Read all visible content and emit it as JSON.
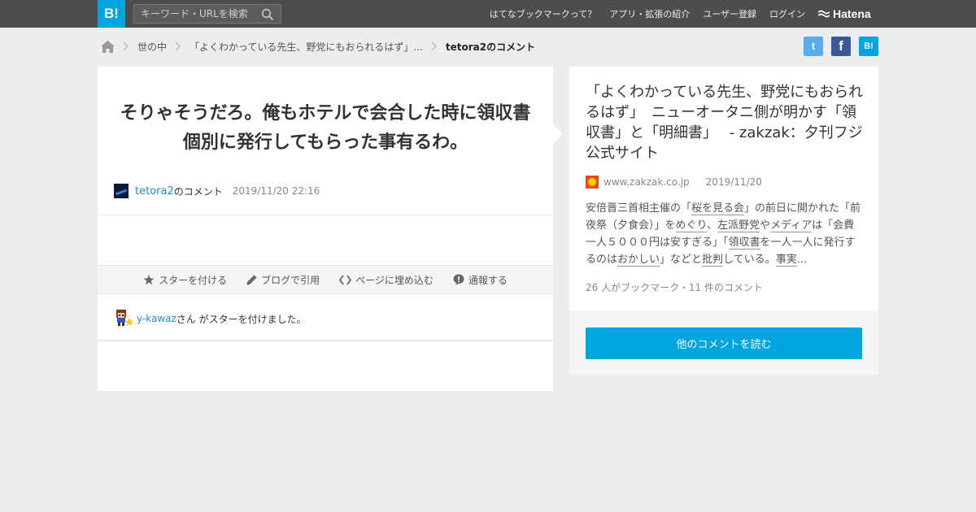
{
  "header": {
    "logo": "B!",
    "search_placeholder": "キーワード・URLを検索",
    "nav": [
      "はてなブックマークって？",
      "アプリ・拡張の紹介",
      "ユーザー登録",
      "ログイン"
    ],
    "hatena": "Hatena"
  },
  "breadcrumb": {
    "category": "世の中",
    "entry": "「よくわかっている先生、野党にもおられるはず」...",
    "current": "tetora2のコメント"
  },
  "share": {
    "twitter": "t",
    "facebook": "f",
    "hatebu": "B!"
  },
  "comment": {
    "text": "そりゃそうだろ。俺もホテルで会合した時に領収書個別に発行してもらった事有るわ。",
    "user": "tetora2",
    "no_comment": "のコメント",
    "timestamp": "2019/11/20 22:16"
  },
  "actions": {
    "star": "スターを付ける",
    "blog": "ブログで引用",
    "embed": "ページに埋め込む",
    "report": "通報する"
  },
  "stars": {
    "user": "y-kawaz",
    "text": "さん がスターを付けました。"
  },
  "entry": {
    "title": "「よくわかっている先生、野党にもおられるはず」　ニューオータニ側が明かす「領収書」と「明細書」　 - zakzak：夕刊フジ公式サイト",
    "domain": "www.zakzak.co.jp",
    "date": "2019/11/20",
    "summary_parts": [
      {
        "t": "安倍晋三首相主催の「",
        "u": false
      },
      {
        "t": "桜を見る会",
        "u": true
      },
      {
        "t": "」の前日に開かれた「前夜祭（夕食会）」を",
        "u": false
      },
      {
        "t": "めぐり",
        "u": true
      },
      {
        "t": "、",
        "u": false
      },
      {
        "t": "左派",
        "u": true
      },
      {
        "t": "野党",
        "u": true
      },
      {
        "t": "や",
        "u": false
      },
      {
        "t": "メディア",
        "u": true
      },
      {
        "t": "は「会費一人５０００円は安すぎる」「",
        "u": false
      },
      {
        "t": "領収書",
        "u": true
      },
      {
        "t": "を一人一人に発行するのは",
        "u": false
      },
      {
        "t": "おかしい",
        "u": true
      },
      {
        "t": "」などと",
        "u": false
      },
      {
        "t": "批判",
        "u": true
      },
      {
        "t": "している。",
        "u": false
      },
      {
        "t": "事実",
        "u": true
      },
      {
        "t": "...",
        "u": false
      }
    ],
    "counts": "26 人がブックマーク・11 件のコメント",
    "read_more": "他のコメントを読む"
  },
  "colors": {
    "accent": "#00a4de",
    "topbar": "#4d4d4d",
    "link": "#1a8fbf",
    "background": "#ebedef"
  }
}
